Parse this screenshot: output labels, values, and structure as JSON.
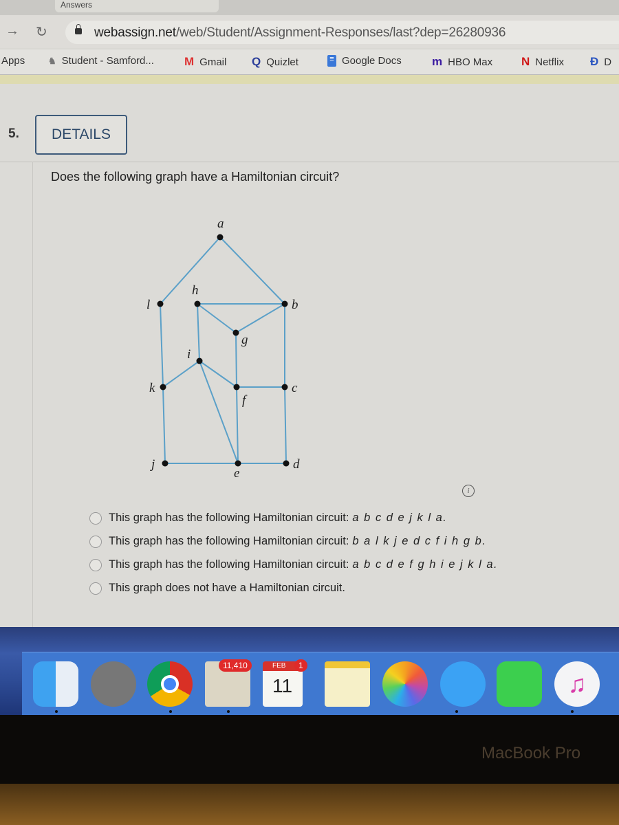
{
  "browser": {
    "tab_title": "Answers",
    "url_domain": "webassign.net",
    "url_path": "/web/Student/Assignment-Responses/last?dep=26280936",
    "bookmarks": [
      {
        "label": "Apps",
        "icon": "apps-icon"
      },
      {
        "label": "Student - Samford...",
        "icon": "samford-icon"
      },
      {
        "label": "Gmail",
        "icon": "gmail-icon"
      },
      {
        "label": "Quizlet",
        "icon": "quizlet-icon"
      },
      {
        "label": "Google Docs",
        "icon": "google-docs-icon"
      },
      {
        "label": "HBO Max",
        "icon": "hbo-max-icon"
      },
      {
        "label": "Netflix",
        "icon": "netflix-icon"
      },
      {
        "label": "D",
        "icon": "disney-icon"
      }
    ]
  },
  "question": {
    "number": "5.",
    "details_label": "DETAILS",
    "prompt": "Does the following graph have a Hamiltonian circuit?",
    "graph": {
      "vertices": [
        "a",
        "b",
        "c",
        "d",
        "e",
        "f",
        "g",
        "h",
        "i",
        "j",
        "k",
        "l"
      ],
      "edges": [
        [
          "a",
          "l"
        ],
        [
          "a",
          "b"
        ],
        [
          "l",
          "k"
        ],
        [
          "k",
          "j"
        ],
        [
          "h",
          "b"
        ],
        [
          "h",
          "g"
        ],
        [
          "g",
          "b"
        ],
        [
          "h",
          "i"
        ],
        [
          "g",
          "f"
        ],
        [
          "i",
          "k"
        ],
        [
          "i",
          "f"
        ],
        [
          "i",
          "e"
        ],
        [
          "f",
          "c"
        ],
        [
          "b",
          "c"
        ],
        [
          "c",
          "d"
        ],
        [
          "j",
          "e"
        ],
        [
          "e",
          "d"
        ],
        [
          "f",
          "e"
        ]
      ],
      "edge_color": "#5ba0c8"
    },
    "options": [
      {
        "text": "This graph has the following Hamiltonian circuit:",
        "sequence": "a b c d e j k l a."
      },
      {
        "text": "This graph has the following Hamiltonian circuit:",
        "sequence": "b a l k j e d c f i h g b."
      },
      {
        "text": "This graph has the following Hamiltonian circuit:",
        "sequence": "a b c d e f g h i e j k l a."
      },
      {
        "text": "This graph does not have a Hamiltonian circuit.",
        "sequence": ""
      }
    ]
  },
  "dock": {
    "mail_badge": "11,410",
    "calendar_month": "FEB",
    "calendar_day": "11",
    "calendar_badge": "1"
  },
  "laptop": {
    "brand": "MacBook Pro"
  }
}
